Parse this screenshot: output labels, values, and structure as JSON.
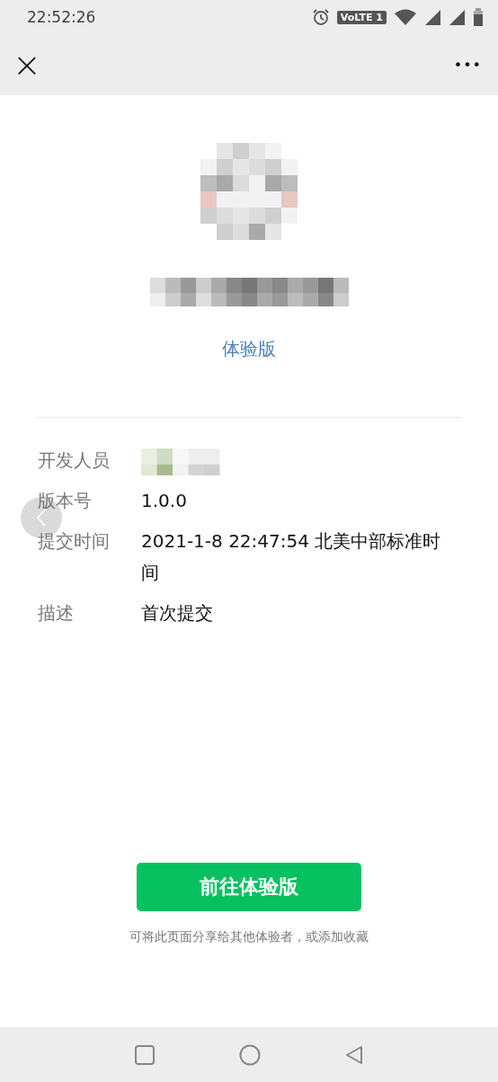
{
  "status_bar": {
    "time": "22:52:26",
    "network_badge": "VoLTE 1"
  },
  "nav_bar": {
    "close": "×",
    "more": "•••"
  },
  "app": {
    "version_tag": "体验版"
  },
  "details": [
    {
      "label": "开发人员",
      "kind": "redacted"
    },
    {
      "label": "版本号",
      "kind": "text",
      "value": "1.0.0"
    },
    {
      "label": "提交时间",
      "kind": "text",
      "value": "2021-1-8 22:47:54 北美中部标准时间"
    },
    {
      "label": "描述",
      "kind": "text",
      "value": "首次提交"
    }
  ],
  "action_button": "前往体验版",
  "hint": "可将此页面分享给其他体验者，或添加收藏"
}
